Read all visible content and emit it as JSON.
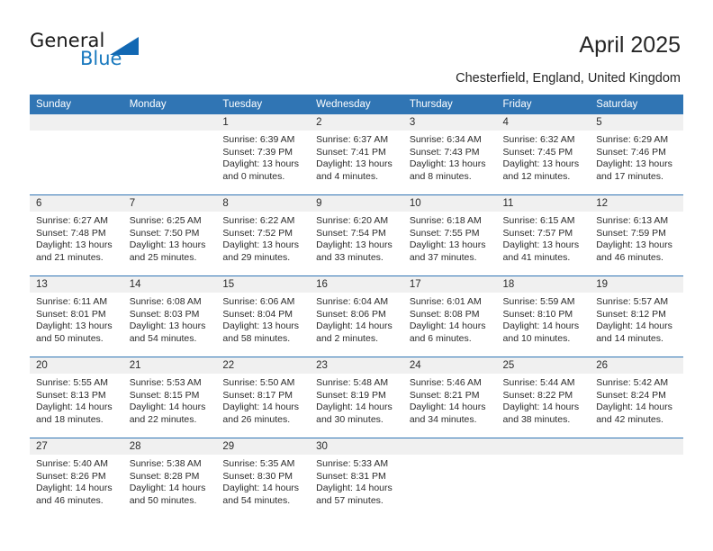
{
  "brand": {
    "name_part1": "General",
    "name_part2": "Blue",
    "logo_icon": "triangle-logo-icon",
    "accent_color": "#1268b3"
  },
  "header": {
    "title": "April 2025",
    "location": "Chesterfield, England, United Kingdom"
  },
  "theme": {
    "header_bar_color": "#3075b4",
    "daynum_band_color": "#f0f0f0",
    "row_divider_color": "#3075b4",
    "text_color": "#2b2b2b"
  },
  "weekday_headers": [
    "Sunday",
    "Monday",
    "Tuesday",
    "Wednesday",
    "Thursday",
    "Friday",
    "Saturday"
  ],
  "weeks": [
    [
      {
        "day": "",
        "empty": true
      },
      {
        "day": "",
        "empty": true
      },
      {
        "day": "1",
        "sunrise": "Sunrise: 6:39 AM",
        "sunset": "Sunset: 7:39 PM",
        "daylight_line1": "Daylight: 13 hours",
        "daylight_line2": "and 0 minutes."
      },
      {
        "day": "2",
        "sunrise": "Sunrise: 6:37 AM",
        "sunset": "Sunset: 7:41 PM",
        "daylight_line1": "Daylight: 13 hours",
        "daylight_line2": "and 4 minutes."
      },
      {
        "day": "3",
        "sunrise": "Sunrise: 6:34 AM",
        "sunset": "Sunset: 7:43 PM",
        "daylight_line1": "Daylight: 13 hours",
        "daylight_line2": "and 8 minutes."
      },
      {
        "day": "4",
        "sunrise": "Sunrise: 6:32 AM",
        "sunset": "Sunset: 7:45 PM",
        "daylight_line1": "Daylight: 13 hours",
        "daylight_line2": "and 12 minutes."
      },
      {
        "day": "5",
        "sunrise": "Sunrise: 6:29 AM",
        "sunset": "Sunset: 7:46 PM",
        "daylight_line1": "Daylight: 13 hours",
        "daylight_line2": "and 17 minutes."
      }
    ],
    [
      {
        "day": "6",
        "sunrise": "Sunrise: 6:27 AM",
        "sunset": "Sunset: 7:48 PM",
        "daylight_line1": "Daylight: 13 hours",
        "daylight_line2": "and 21 minutes."
      },
      {
        "day": "7",
        "sunrise": "Sunrise: 6:25 AM",
        "sunset": "Sunset: 7:50 PM",
        "daylight_line1": "Daylight: 13 hours",
        "daylight_line2": "and 25 minutes."
      },
      {
        "day": "8",
        "sunrise": "Sunrise: 6:22 AM",
        "sunset": "Sunset: 7:52 PM",
        "daylight_line1": "Daylight: 13 hours",
        "daylight_line2": "and 29 minutes."
      },
      {
        "day": "9",
        "sunrise": "Sunrise: 6:20 AM",
        "sunset": "Sunset: 7:54 PM",
        "daylight_line1": "Daylight: 13 hours",
        "daylight_line2": "and 33 minutes."
      },
      {
        "day": "10",
        "sunrise": "Sunrise: 6:18 AM",
        "sunset": "Sunset: 7:55 PM",
        "daylight_line1": "Daylight: 13 hours",
        "daylight_line2": "and 37 minutes."
      },
      {
        "day": "11",
        "sunrise": "Sunrise: 6:15 AM",
        "sunset": "Sunset: 7:57 PM",
        "daylight_line1": "Daylight: 13 hours",
        "daylight_line2": "and 41 minutes."
      },
      {
        "day": "12",
        "sunrise": "Sunrise: 6:13 AM",
        "sunset": "Sunset: 7:59 PM",
        "daylight_line1": "Daylight: 13 hours",
        "daylight_line2": "and 46 minutes."
      }
    ],
    [
      {
        "day": "13",
        "sunrise": "Sunrise: 6:11 AM",
        "sunset": "Sunset: 8:01 PM",
        "daylight_line1": "Daylight: 13 hours",
        "daylight_line2": "and 50 minutes."
      },
      {
        "day": "14",
        "sunrise": "Sunrise: 6:08 AM",
        "sunset": "Sunset: 8:03 PM",
        "daylight_line1": "Daylight: 13 hours",
        "daylight_line2": "and 54 minutes."
      },
      {
        "day": "15",
        "sunrise": "Sunrise: 6:06 AM",
        "sunset": "Sunset: 8:04 PM",
        "daylight_line1": "Daylight: 13 hours",
        "daylight_line2": "and 58 minutes."
      },
      {
        "day": "16",
        "sunrise": "Sunrise: 6:04 AM",
        "sunset": "Sunset: 8:06 PM",
        "daylight_line1": "Daylight: 14 hours",
        "daylight_line2": "and 2 minutes."
      },
      {
        "day": "17",
        "sunrise": "Sunrise: 6:01 AM",
        "sunset": "Sunset: 8:08 PM",
        "daylight_line1": "Daylight: 14 hours",
        "daylight_line2": "and 6 minutes."
      },
      {
        "day": "18",
        "sunrise": "Sunrise: 5:59 AM",
        "sunset": "Sunset: 8:10 PM",
        "daylight_line1": "Daylight: 14 hours",
        "daylight_line2": "and 10 minutes."
      },
      {
        "day": "19",
        "sunrise": "Sunrise: 5:57 AM",
        "sunset": "Sunset: 8:12 PM",
        "daylight_line1": "Daylight: 14 hours",
        "daylight_line2": "and 14 minutes."
      }
    ],
    [
      {
        "day": "20",
        "sunrise": "Sunrise: 5:55 AM",
        "sunset": "Sunset: 8:13 PM",
        "daylight_line1": "Daylight: 14 hours",
        "daylight_line2": "and 18 minutes."
      },
      {
        "day": "21",
        "sunrise": "Sunrise: 5:53 AM",
        "sunset": "Sunset: 8:15 PM",
        "daylight_line1": "Daylight: 14 hours",
        "daylight_line2": "and 22 minutes."
      },
      {
        "day": "22",
        "sunrise": "Sunrise: 5:50 AM",
        "sunset": "Sunset: 8:17 PM",
        "daylight_line1": "Daylight: 14 hours",
        "daylight_line2": "and 26 minutes."
      },
      {
        "day": "23",
        "sunrise": "Sunrise: 5:48 AM",
        "sunset": "Sunset: 8:19 PM",
        "daylight_line1": "Daylight: 14 hours",
        "daylight_line2": "and 30 minutes."
      },
      {
        "day": "24",
        "sunrise": "Sunrise: 5:46 AM",
        "sunset": "Sunset: 8:21 PM",
        "daylight_line1": "Daylight: 14 hours",
        "daylight_line2": "and 34 minutes."
      },
      {
        "day": "25",
        "sunrise": "Sunrise: 5:44 AM",
        "sunset": "Sunset: 8:22 PM",
        "daylight_line1": "Daylight: 14 hours",
        "daylight_line2": "and 38 minutes."
      },
      {
        "day": "26",
        "sunrise": "Sunrise: 5:42 AM",
        "sunset": "Sunset: 8:24 PM",
        "daylight_line1": "Daylight: 14 hours",
        "daylight_line2": "and 42 minutes."
      }
    ],
    [
      {
        "day": "27",
        "sunrise": "Sunrise: 5:40 AM",
        "sunset": "Sunset: 8:26 PM",
        "daylight_line1": "Daylight: 14 hours",
        "daylight_line2": "and 46 minutes."
      },
      {
        "day": "28",
        "sunrise": "Sunrise: 5:38 AM",
        "sunset": "Sunset: 8:28 PM",
        "daylight_line1": "Daylight: 14 hours",
        "daylight_line2": "and 50 minutes."
      },
      {
        "day": "29",
        "sunrise": "Sunrise: 5:35 AM",
        "sunset": "Sunset: 8:30 PM",
        "daylight_line1": "Daylight: 14 hours",
        "daylight_line2": "and 54 minutes."
      },
      {
        "day": "30",
        "sunrise": "Sunrise: 5:33 AM",
        "sunset": "Sunset: 8:31 PM",
        "daylight_line1": "Daylight: 14 hours",
        "daylight_line2": "and 57 minutes."
      },
      {
        "day": "",
        "empty": true
      },
      {
        "day": "",
        "empty": true
      },
      {
        "day": "",
        "empty": true
      }
    ]
  ]
}
